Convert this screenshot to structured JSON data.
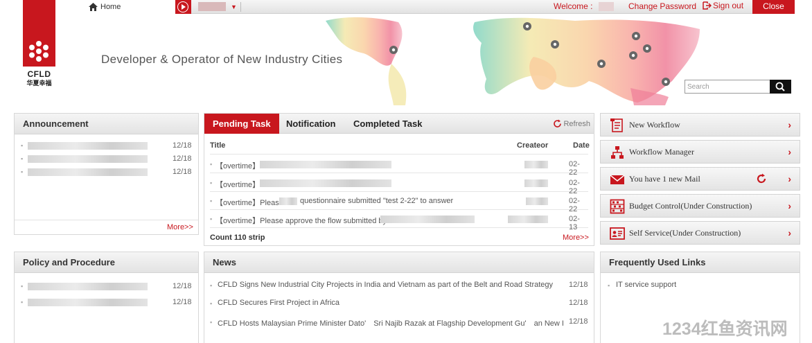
{
  "header": {
    "logo_text": "CFLD",
    "logo_subtext": "华夏幸福",
    "home_label": "Home",
    "tagline": "Developer & Operator of New Industry Cities",
    "welcome_label": "Welcome :",
    "change_password_label": "Change Password",
    "sign_out_label": "Sign out",
    "close_label": "Close",
    "search_placeholder": "Search",
    "accent_color": "#c8171e"
  },
  "announcement": {
    "title": "Announcement",
    "items": [
      {
        "date": "12/18"
      },
      {
        "date": "12/18"
      },
      {
        "date": "12/18"
      }
    ],
    "more_label": "More>>"
  },
  "tasks": {
    "tabs": [
      {
        "label": "Pending Task",
        "active": true
      },
      {
        "label": "Notification",
        "active": false
      },
      {
        "label": "Completed Task",
        "active": false
      }
    ],
    "refresh_label": "Refresh",
    "columns": {
      "title": "Title",
      "creator": "Createor",
      "date": "Date"
    },
    "rows": [
      {
        "title": "【overtime】",
        "date": "02-22"
      },
      {
        "title": "【overtime】",
        "date": "02-22"
      },
      {
        "title": "【overtime】Please",
        "title_suffix": "questionnaire submitted \"test 2-22\" to answer",
        "date": "02-22"
      },
      {
        "title": "【overtime】Please approve the flow submitted by",
        "date": "02-13"
      }
    ],
    "count_label": "Count 110 strip",
    "more_label": "More>>"
  },
  "quick_menu": {
    "items": [
      {
        "label": "New Workflow",
        "icon": "document-icon"
      },
      {
        "label": "Workflow Manager",
        "icon": "org-chart-icon"
      },
      {
        "label": "You have  1  new Mail",
        "icon": "mail-icon"
      },
      {
        "label": "Budget Control(Under Construction)",
        "icon": "abacus-icon"
      },
      {
        "label": "Self Service(Under Construction)",
        "icon": "id-card-icon"
      }
    ]
  },
  "policy": {
    "title": "Policy and Procedure",
    "items": [
      {
        "date": "12/18"
      },
      {
        "date": "12/18"
      }
    ]
  },
  "news": {
    "title": "News",
    "items": [
      {
        "text": "CFLD Signs New Industrial City Projects in India and Vietnam as part of the Belt and Road Strategy",
        "date": "12/18"
      },
      {
        "text": "CFLD Secures First Project in Africa",
        "date": "12/18"
      },
      {
        "text": "CFLD Hosts Malaysian Prime Minister Dato'　Sri Najib Razak at Flagship Development Gu'　an New I...",
        "date": "12/18"
      }
    ]
  },
  "links": {
    "title": "Frequently Used Links",
    "items": [
      {
        "label": "IT service support"
      }
    ]
  },
  "watermark": "1234红鱼资讯网"
}
